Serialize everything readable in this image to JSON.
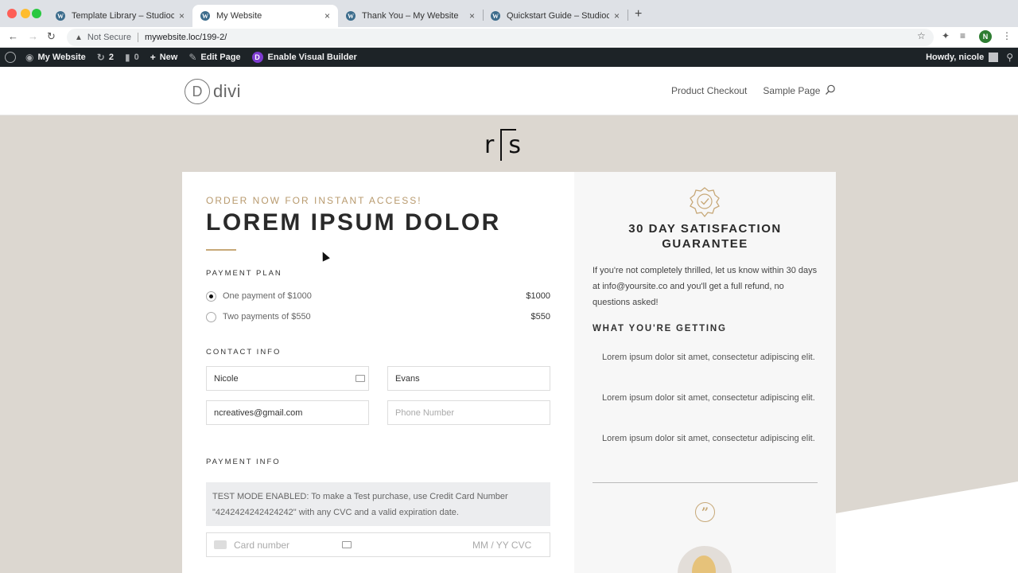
{
  "browser": {
    "tabs": [
      {
        "label": "Template Library – Studiocart",
        "active": false
      },
      {
        "label": "My Website",
        "active": true
      },
      {
        "label": "Thank You – My Website",
        "active": false
      },
      {
        "label": "Quickstart Guide – Studiocart",
        "active": false
      }
    ],
    "not_secure": "Not Secure",
    "url": "mywebsite.loc/199-2/",
    "profile_initial": "N"
  },
  "adminbar": {
    "site_name": "My Website",
    "updates_count": "2",
    "comments_count": "0",
    "new_label": "New",
    "edit_label": "Edit Page",
    "visual_builder_label": "Enable Visual Builder",
    "divi_letter": "D",
    "howdy": "Howdy, nicole"
  },
  "header": {
    "logo_letter": "D",
    "logo_text": "divi",
    "nav": [
      "Product Checkout",
      "Sample Page"
    ]
  },
  "brand": {
    "left": "r",
    "right": "s"
  },
  "checkout": {
    "eyebrow": "ORDER NOW FOR INSTANT ACCESS!",
    "headline": "LOREM IPSUM DOLOR",
    "payment_plan_label": "PAYMENT PLAN",
    "plans": [
      {
        "label": "One payment of $1000",
        "price": "$1000",
        "selected": true
      },
      {
        "label": "Two payments of $550",
        "price": "$550",
        "selected": false
      }
    ],
    "contact_label": "CONTACT INFO",
    "first_name": "Nicole",
    "last_name": "Evans",
    "email": "ncreatives@gmail.com",
    "phone_placeholder": "Phone Number",
    "payment_label": "PAYMENT INFO",
    "test_notice": "TEST MODE ENABLED: To make a Test purchase, use Credit Card Number \"4242424242424242\" with any CVC and a valid expiration date.",
    "card_placeholder": "Card number",
    "expiry_cvc_placeholder": "MM / YY  CVC"
  },
  "sidebar": {
    "guarantee_title": "30 DAY SATISFACTION GUARANTEE",
    "guarantee_text": "If you're not completely thrilled, let us know within 30 days at info@yoursite.co and you'll get a full refund, no questions asked!",
    "getting_title": "WHAT YOU'RE GETTING",
    "bullets": [
      "Lorem ipsum dolor sit amet, consectetur adipiscing elit.",
      "Lorem ipsum dolor sit amet, consectetur adipiscing elit.",
      "Lorem ipsum dolor sit amet, consectetur adipiscing elit."
    ],
    "quote_glyph": "”"
  },
  "colors": {
    "accent_gold": "#c7a878",
    "adminbar_bg": "#1d2327",
    "page_bg": "#dcd7d0"
  }
}
